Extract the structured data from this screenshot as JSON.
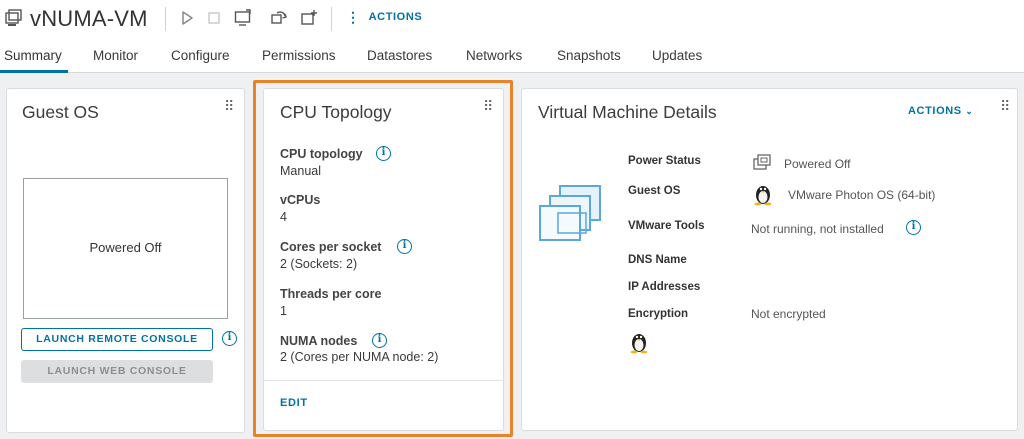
{
  "header": {
    "vm_name": "vNUMA-VM",
    "actions_label": "ACTIONS"
  },
  "tabs": [
    {
      "label": "Summary",
      "active": true
    },
    {
      "label": "Monitor"
    },
    {
      "label": "Configure"
    },
    {
      "label": "Permissions"
    },
    {
      "label": "Datastores"
    },
    {
      "label": "Networks"
    },
    {
      "label": "Snapshots"
    },
    {
      "label": "Updates"
    }
  ],
  "guest_os": {
    "title": "Guest OS",
    "console_status": "Powered Off",
    "launch_remote_label": "LAUNCH REMOTE CONSOLE",
    "launch_web_label": "LAUNCH WEB CONSOLE"
  },
  "cpu_topology": {
    "title": "CPU Topology",
    "fields": [
      {
        "label": "CPU topology",
        "value": "Manual"
      },
      {
        "label": "vCPUs",
        "value": "4"
      },
      {
        "label": "Cores per socket",
        "value": "2 (Sockets: 2)"
      },
      {
        "label": "Threads per core",
        "value": "1"
      },
      {
        "label": "NUMA nodes",
        "value": "2 (Cores per NUMA node: 2)"
      }
    ],
    "edit_label": "EDIT"
  },
  "vm_details": {
    "title": "Virtual Machine Details",
    "actions_label": "ACTIONS",
    "rows": [
      {
        "label": "Power Status",
        "value": "Powered Off"
      },
      {
        "label": "Guest OS",
        "value": "VMware Photon OS (64-bit)"
      },
      {
        "label": "VMware Tools",
        "value": "Not running, not installed"
      },
      {
        "label": "DNS Name",
        "value": ""
      },
      {
        "label": "IP Addresses",
        "value": ""
      },
      {
        "label": "Encryption",
        "value": "Not encrypted"
      }
    ]
  },
  "colors": {
    "accent": "#0072a3",
    "highlight": "#e8832a"
  },
  "icons": [
    "vm-icon",
    "power-on-icon",
    "power-off-icon",
    "console-icon",
    "migrate-icon",
    "new-vm-icon",
    "kebab-icon",
    "grip-icon",
    "info-icon",
    "vm-stack-icon",
    "linux-penguin-icon",
    "chevron-down-icon"
  ]
}
